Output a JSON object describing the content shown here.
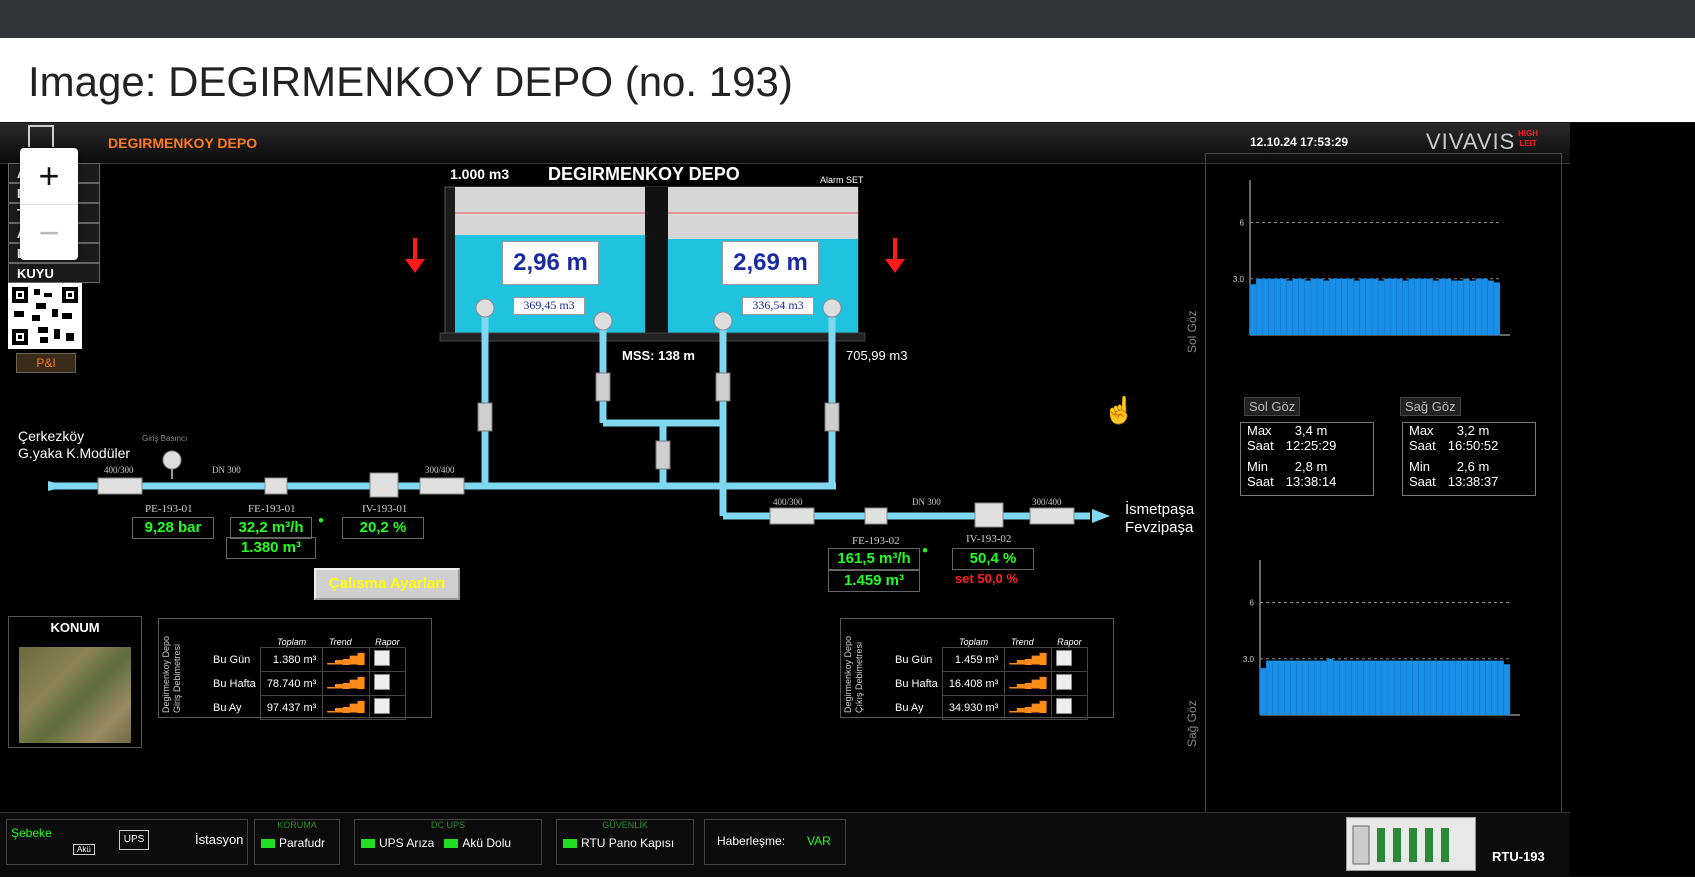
{
  "page_title": "Image: DEGIRMENKOY DEPO (no. 193)",
  "header": {
    "station": "DEGIRMENKOY DEPO",
    "datetime": "12.10.24 17:53:29",
    "brand": "VIVAVIS",
    "brand_sub": "HIGH LEIT"
  },
  "zoom": {
    "plus": "+",
    "minus": "−"
  },
  "nav": {
    "items": [
      "A",
      "D",
      "T",
      "A",
      "DEPO",
      "KUYU"
    ],
    "pid": "P&I"
  },
  "tank": {
    "capacity": "1.000 m3",
    "name": "DEGIRMENKOY DEPO",
    "alarm": "Alarm SET",
    "left_level": "2,96 m",
    "left_volume": "369,45 m3",
    "right_level": "2,69 m",
    "right_volume": "336,54 m3",
    "total_volume": "705,99 m3",
    "mss": "MSS: 138 m"
  },
  "inlet": {
    "source_line1": "Çerkezköy",
    "source_line2": "G.yaka K.Modüler",
    "pressure_label": "Giriş Basıncı",
    "reducer1": "400/300",
    "dn": "DN 300",
    "reducer2": "300/400",
    "pe_tag": "PE-193-01",
    "pressure": "9,28 bar",
    "fe_tag": "FE-193-01",
    "flow": "32,2 m³/h",
    "total": "1.380   m³",
    "iv_tag": "IV-193-01",
    "valve": "20,2  %"
  },
  "outlet": {
    "reducer1": "400/300",
    "dn": "DN 300",
    "reducer2": "300/400",
    "fe_tag": "FE-193-02",
    "flow": "161,5 m³/h",
    "total": "1.459    m³",
    "iv_tag": "IV-193-02",
    "valve": "50,4  %",
    "setpoint": "set 50,0  %",
    "dest_line1": "İsmetpaşa",
    "dest_line2": "Fevzipaşa"
  },
  "settings_button": "Çalısma Ayarları",
  "location": {
    "title": "KONUM"
  },
  "inlet_table": {
    "side_label": "Degirmenkoy Depo Giriş Debimetresi",
    "headers": [
      "Toplam",
      "Trend",
      "Rapor"
    ],
    "rows": [
      {
        "label": "Bu Gün",
        "value": "1.380 m³"
      },
      {
        "label": "Bu Hafta",
        "value": "78.740 m³"
      },
      {
        "label": "Bu Ay",
        "value": "97.437 m³"
      }
    ]
  },
  "outlet_table": {
    "side_label": "Degirmenkoy Depo Çıkış Debimetresi",
    "headers": [
      "Toplam",
      "Trend",
      "Rapor"
    ],
    "rows": [
      {
        "label": "Bu Gün",
        "value": "1.459 m³"
      },
      {
        "label": "Bu Hafta",
        "value": "16.408 m³"
      },
      {
        "label": "Bu Ay",
        "value": "34.930 m³"
      }
    ]
  },
  "stats": {
    "left": {
      "title": "Sol Göz",
      "max_label": "Max",
      "max_value": "3,4 m",
      "max_time_label": "Saat",
      "max_time": "12:25:29",
      "min_label": "Min",
      "min_value": "2,8 m",
      "min_time_label": "Saat",
      "min_time": "13:38:14"
    },
    "right": {
      "title": "Sağ Göz",
      "max_label": "Max",
      "max_value": "3,2 m",
      "max_time_label": "Saat",
      "max_time": "16:50:52",
      "min_label": "Min",
      "min_value": "2,6 m",
      "min_time_label": "Saat",
      "min_time": "13:38:37"
    }
  },
  "chart_data": [
    {
      "type": "bar",
      "title": "",
      "ylabel": "m",
      "side_label": "Sol Göz",
      "ylim": [
        0,
        8
      ],
      "yticks": [
        "6",
        "3.0"
      ],
      "values": [
        2.7,
        3.0,
        3.0,
        3.0,
        3.0,
        3.0,
        2.9,
        3.0,
        3.0,
        2.9,
        3.0,
        3.0,
        2.9,
        3.0,
        3.0,
        3.0,
        3.0,
        2.9,
        3.0,
        3.0,
        3.0,
        2.9,
        3.0,
        3.0,
        3.0,
        2.9,
        3.0,
        3.0,
        3.0,
        3.0,
        2.9,
        3.0,
        3.0,
        2.9,
        2.9,
        3.0,
        2.9,
        3.0,
        3.0,
        2.9,
        2.8
      ]
    },
    {
      "type": "bar",
      "title": "",
      "ylabel": "m",
      "side_label": "Sağ Göz",
      "ylim": [
        0,
        8
      ],
      "yticks": [
        "6",
        "3.0"
      ],
      "values": [
        2.5,
        2.9,
        2.9,
        2.9,
        2.9,
        2.9,
        2.9,
        2.9,
        2.9,
        2.9,
        2.9,
        3.0,
        2.9,
        2.9,
        2.9,
        2.9,
        2.9,
        2.9,
        2.9,
        2.9,
        2.9,
        2.9,
        2.9,
        2.9,
        2.9,
        2.9,
        2.9,
        2.9,
        2.9,
        2.9,
        2.9,
        2.9,
        2.9,
        2.9,
        2.9,
        2.9,
        2.9,
        2.9,
        2.9,
        2.9,
        2.7
      ]
    }
  ],
  "bottom": {
    "grid": "Şebeke",
    "ups": "UPS",
    "aku": "Akü",
    "station": "İstasyon",
    "koruma_title": "KORUMA",
    "koruma_item": "Parafudr",
    "dcups_title": "DC UPS",
    "ups_fault": "UPS Arıza",
    "battery": "Akü Dolu",
    "guvenlik_title": "GÜVENLİK",
    "door": "RTU Pano Kapısı",
    "comm_label": "Haberleşme:",
    "comm_value": "VAR",
    "rtu": "RTU-193"
  },
  "colors": {
    "pipe": "#7fd8f0",
    "water": "#1fc3e0",
    "bar": "#1a8fe8",
    "alarm_arrow": "#ff1a1a"
  }
}
